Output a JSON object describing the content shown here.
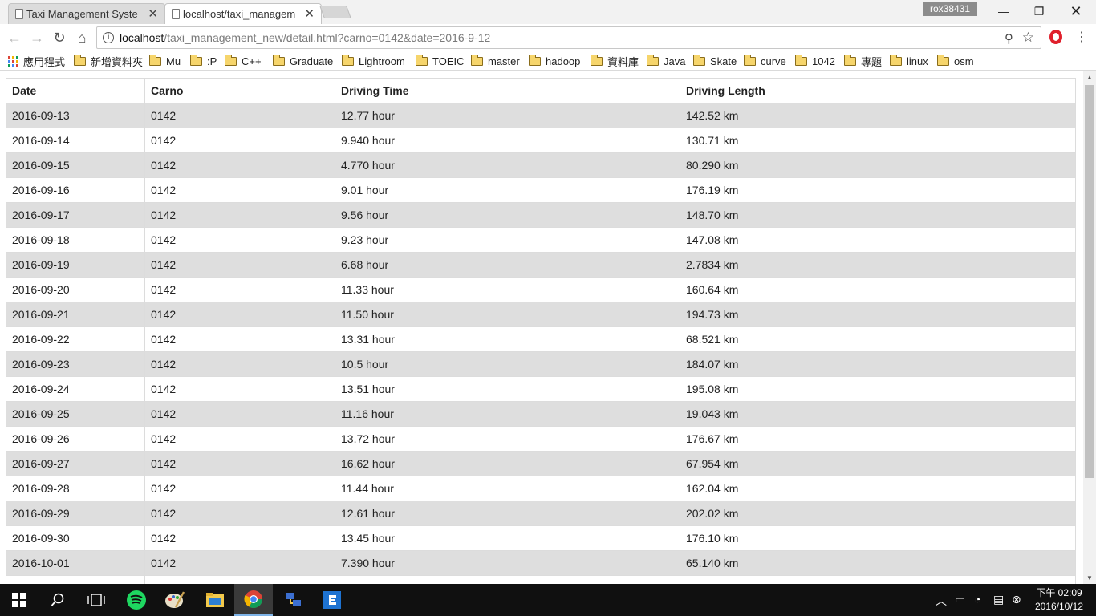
{
  "browser": {
    "tabs": [
      {
        "title": "Taxi Management Syste",
        "active": false
      },
      {
        "title": "localhost/taxi_managem",
        "active": true
      }
    ],
    "profile_name": "rox38431",
    "url_host": "localhost",
    "url_rest": "/taxi_management_new/detail.html?carno=0142&date=2016-9-12",
    "bookmarks": [
      {
        "label": "應用程式",
        "type": "apps"
      },
      {
        "label": "新增資料夾",
        "type": "folder"
      },
      {
        "label": "Mu",
        "type": "folder"
      },
      {
        "label": ":P",
        "type": "folder"
      },
      {
        "label": "C++",
        "type": "folder"
      },
      {
        "label": "Graduate",
        "type": "folder"
      },
      {
        "label": "Lightroom",
        "type": "folder"
      },
      {
        "label": "TOEIC",
        "type": "folder"
      },
      {
        "label": "master",
        "type": "folder"
      },
      {
        "label": "hadoop",
        "type": "folder"
      },
      {
        "label": "資料庫",
        "type": "folder"
      },
      {
        "label": "Java",
        "type": "folder"
      },
      {
        "label": "Skate",
        "type": "folder"
      },
      {
        "label": "curve",
        "type": "folder"
      },
      {
        "label": "1042",
        "type": "folder"
      },
      {
        "label": "專題",
        "type": "folder"
      },
      {
        "label": "linux",
        "type": "folder"
      },
      {
        "label": "osm",
        "type": "folder"
      }
    ]
  },
  "table": {
    "headers": [
      "Date",
      "Carno",
      "Driving Time",
      "Driving Length"
    ],
    "rows": [
      [
        "2016-09-13",
        "0142",
        "12.77 hour",
        "142.52 km"
      ],
      [
        "2016-09-14",
        "0142",
        "9.940 hour",
        "130.71 km"
      ],
      [
        "2016-09-15",
        "0142",
        "4.770 hour",
        "80.290 km"
      ],
      [
        "2016-09-16",
        "0142",
        "9.01 hour",
        "176.19 km"
      ],
      [
        "2016-09-17",
        "0142",
        "9.56 hour",
        "148.70 km"
      ],
      [
        "2016-09-18",
        "0142",
        "9.23 hour",
        "147.08 km"
      ],
      [
        "2016-09-19",
        "0142",
        "6.68 hour",
        "2.7834 km"
      ],
      [
        "2016-09-20",
        "0142",
        "11.33 hour",
        "160.64 km"
      ],
      [
        "2016-09-21",
        "0142",
        "11.50 hour",
        "194.73 km"
      ],
      [
        "2016-09-22",
        "0142",
        "13.31 hour",
        "68.521 km"
      ],
      [
        "2016-09-23",
        "0142",
        "10.5 hour",
        "184.07 km"
      ],
      [
        "2016-09-24",
        "0142",
        "13.51 hour",
        "195.08 km"
      ],
      [
        "2016-09-25",
        "0142",
        "11.16 hour",
        "19.043 km"
      ],
      [
        "2016-09-26",
        "0142",
        "13.72 hour",
        "176.67 km"
      ],
      [
        "2016-09-27",
        "0142",
        "16.62 hour",
        "67.954 km"
      ],
      [
        "2016-09-28",
        "0142",
        "11.44 hour",
        "162.04 km"
      ],
      [
        "2016-09-29",
        "0142",
        "12.61 hour",
        "202.02 km"
      ],
      [
        "2016-09-30",
        "0142",
        "13.45 hour",
        "176.10 km"
      ],
      [
        "2016-10-01",
        "0142",
        "7.390 hour",
        "65.140 km"
      ],
      [
        "",
        "",
        "",
        ""
      ]
    ]
  },
  "taskbar": {
    "apps": [
      "start-icon",
      "search-icon",
      "task-view-icon",
      "spotify-icon",
      "paint-icon",
      "file-explorer-icon",
      "chrome-icon",
      "network-app-icon",
      "editor-app-icon"
    ],
    "clock_time": "下午 02:09",
    "clock_date": "2016/10/12"
  },
  "colors": {
    "row_shade": "#dedede",
    "titlebar": "#f2f2f2",
    "taskbar": "#101010",
    "opera_red": "#e0202c"
  }
}
